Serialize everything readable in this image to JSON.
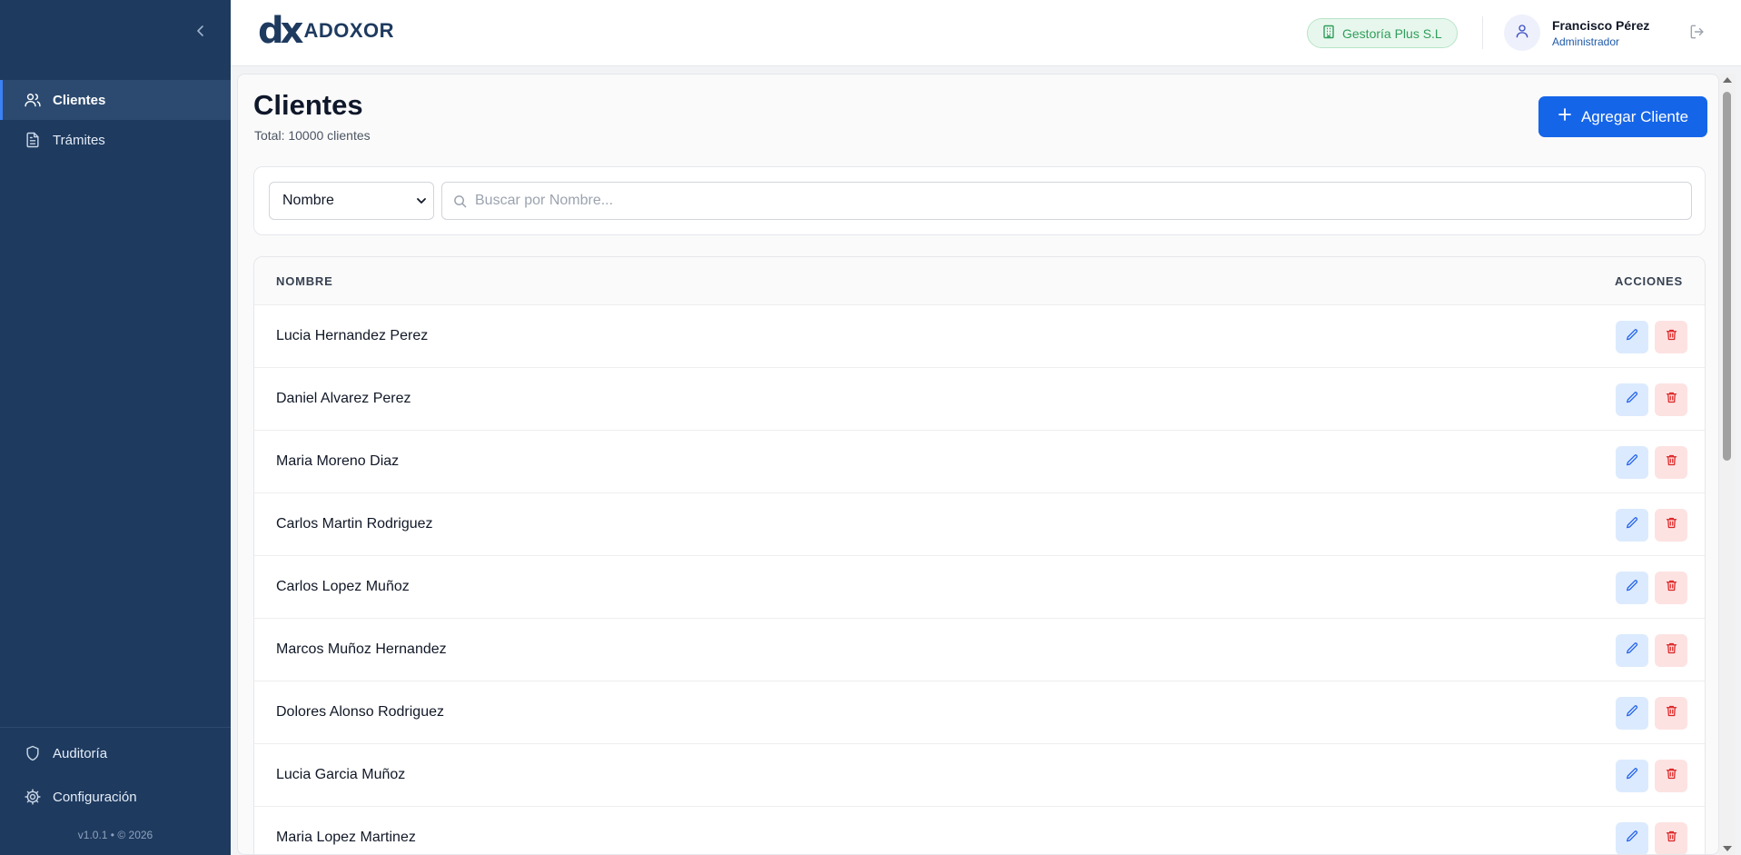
{
  "sidebar": {
    "nav_top": [
      {
        "label": "Clientes",
        "icon": "users-icon",
        "active": true
      },
      {
        "label": "Trámites",
        "icon": "file-text-icon",
        "active": false
      }
    ],
    "nav_bottom": [
      {
        "label": "Auditoría",
        "icon": "shield-icon"
      },
      {
        "label": "Configuración",
        "icon": "gear-icon"
      }
    ],
    "version": "v1.0.1 • © 2026"
  },
  "header": {
    "logo_mark": "dx",
    "logo_text": "ADOXOR",
    "company": "Gestoría Plus S.L",
    "user_name": "Francisco Pérez",
    "user_role": "Administrador"
  },
  "page": {
    "title": "Clientes",
    "subtitle": "Total: 10000 clientes",
    "add_button": "Agregar Cliente"
  },
  "filter": {
    "selected": "Nombre",
    "search_placeholder": "Buscar por Nombre..."
  },
  "table": {
    "col_name": "NOMBRE",
    "col_actions": "ACCIONES",
    "rows": [
      "Lucia Hernandez Perez",
      "Daniel Alvarez Perez",
      "Maria Moreno Diaz",
      "Carlos Martin Rodriguez",
      "Carlos Lopez Muñoz",
      "Marcos Muñoz Hernandez",
      "Dolores Alonso Rodriguez",
      "Lucia Garcia Muñoz",
      "Maria Lopez Martinez"
    ]
  },
  "colors": {
    "sidebar_bg": "#1e3a5f",
    "primary": "#1565e8",
    "badge_green": "#2f9e5a",
    "delete_red": "#dc2626"
  }
}
